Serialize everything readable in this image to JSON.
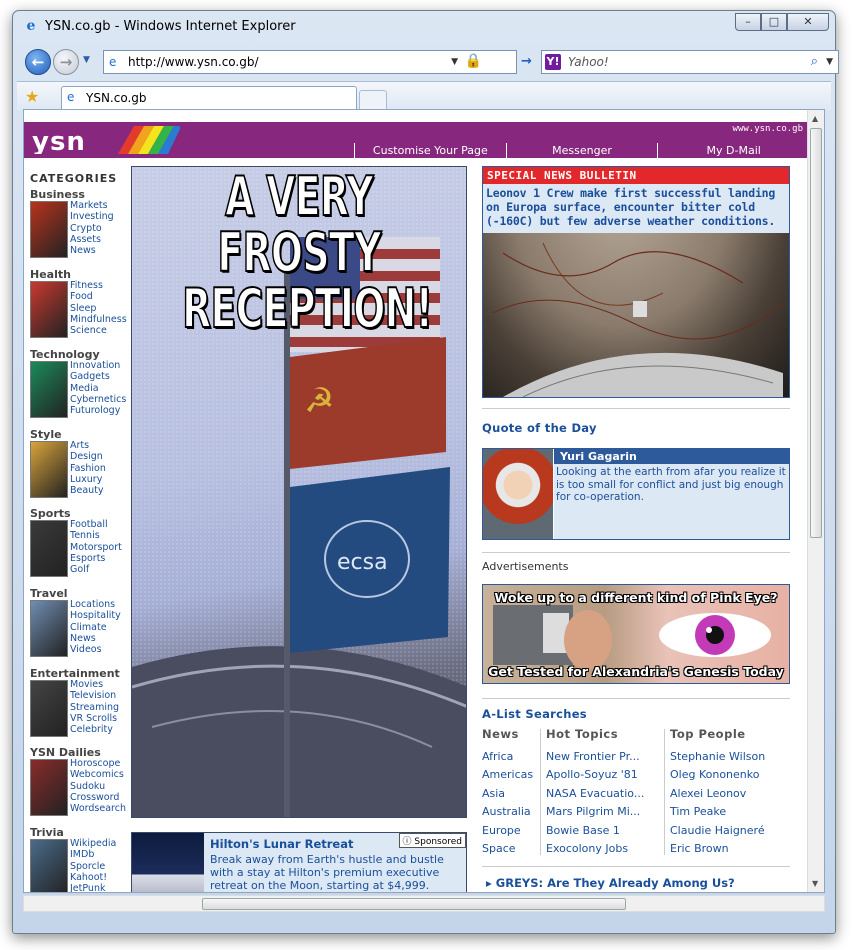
{
  "window": {
    "title": "YSN.co.gb - Windows Internet Explorer",
    "buttons": [
      "minimize",
      "maximize",
      "close"
    ]
  },
  "toolbar": {
    "address": "http://www.ysn.co.gb/",
    "search_placeholder": "Yahoo!",
    "tab_label": "YSN.co.gb"
  },
  "header": {
    "url_tag": "www.ysn.co.gb",
    "logo_text": "ysn",
    "nav": [
      "Customise Your Page",
      "Messenger",
      "My D-Mail"
    ]
  },
  "categories_title": "CATEGORIES",
  "categories": [
    {
      "name": "Business",
      "links": [
        "Markets",
        "Investing",
        "Crypto",
        "Assets",
        "News"
      ],
      "color": "#b8331e"
    },
    {
      "name": "Health",
      "links": [
        "Fitness",
        "Food",
        "Sleep",
        "Mindfulness",
        "Science"
      ],
      "color": "#c73a30"
    },
    {
      "name": "Technology",
      "links": [
        "Innovation",
        "Gadgets",
        "Media",
        "Cybernetics",
        "Futurology"
      ],
      "color": "#1b8a5a"
    },
    {
      "name": "Style",
      "links": [
        "Arts",
        "Design",
        "Fashion",
        "Luxury",
        "Beauty"
      ],
      "color": "#d9a43a"
    },
    {
      "name": "Sports",
      "links": [
        "Football",
        "Tennis",
        "Motorsport",
        "Esports",
        "Golf"
      ],
      "color": "#3a3a3a"
    },
    {
      "name": "Travel",
      "links": [
        "Locations",
        "Hospitality",
        "Climate",
        "News",
        "Videos"
      ],
      "color": "#6f8db2"
    },
    {
      "name": "Entertainment",
      "links": [
        "Movies",
        "Television",
        "Streaming",
        "VR Scrolls",
        "Celebrity"
      ],
      "color": "#444444"
    },
    {
      "name": "YSN Dailies",
      "links": [
        "Horoscope",
        "Webcomics",
        "Sudoku",
        "Crossword",
        "Wordsearch"
      ],
      "color": "#8a2b2b"
    },
    {
      "name": "Trivia",
      "links": [
        "Wikipedia",
        "IMDb",
        "Sporcle",
        "Kahoot!",
        "JetPunk"
      ],
      "color": "#4a6b8a"
    }
  ],
  "hero": {
    "headline": [
      "A VERY FROSTY",
      "RECEPTION!"
    ],
    "flag_label": "ecsa"
  },
  "promo": {
    "title": "Hilton's Lunar Retreat",
    "text": "Break away from Earth's hustle and bustle with a stay at Hilton's premium executive retreat on the Moon, starting at $4,999.",
    "sponsored": "Sponsored"
  },
  "bulletin": {
    "heading": "SPECIAL NEWS BULLETIN",
    "text": "Leonov 1 Crew make first successful landing on Europa surface, encounter bitter cold (-160C) but few adverse weather conditions."
  },
  "quote": {
    "section_title": "Quote of the Day",
    "author": "Yuri Gagarin",
    "text": "Looking at the earth from afar you realize it is too small for conflict and just big enough for co-operation."
  },
  "ads": {
    "label": "Advertisements",
    "line1": "Woke up to a different kind of Pink Eye?",
    "line2": "Get Tested for Alexandria's Genesis Today"
  },
  "alist": {
    "title": "A-List Searches",
    "columns": [
      {
        "heading": "News",
        "items": [
          "Africa",
          "Americas",
          "Asia",
          "Australia",
          "Europe",
          "Space"
        ]
      },
      {
        "heading": "Hot Topics",
        "items": [
          "New Frontier Pr...",
          "Apollo-Soyuz '81",
          "NASA Evacuatio...",
          "Mars Pilgrim Mi...",
          "Bowie Base 1",
          "Exocolony Jobs"
        ]
      },
      {
        "heading": "Top People",
        "items": [
          "Stephanie Wilson",
          "Oleg Kononenko",
          "Alexei Leonov",
          "Tim Peake",
          "Claudie Haigneré",
          "Eric Brown"
        ]
      }
    ],
    "greys_link": "GREYS: Are They Already Among Us?"
  }
}
